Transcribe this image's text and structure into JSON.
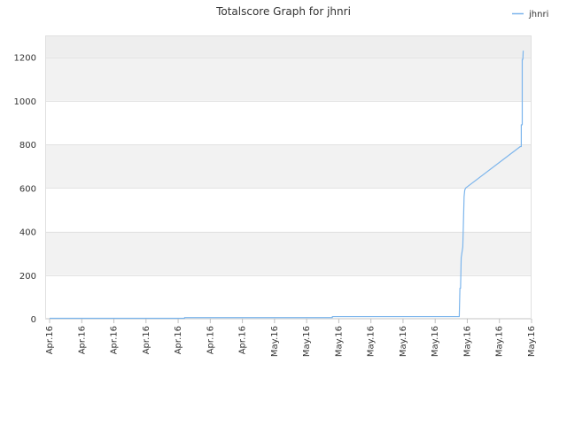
{
  "chart_data": {
    "type": "line",
    "title": "Totalscore Graph for jhnri",
    "xlabel": "",
    "ylabel": "",
    "ylim": [
      0,
      1300
    ],
    "y_ticks": [
      0,
      200,
      400,
      600,
      800,
      1000,
      1200
    ],
    "x_tick_labels": [
      "Apr.16",
      "Apr.16",
      "Apr.16",
      "Apr.16",
      "Apr.16",
      "Apr.16",
      "Apr.16",
      "May.16",
      "May.16",
      "May.16",
      "May.16",
      "May.16",
      "May.16",
      "May.16",
      "May.16",
      "May.16"
    ],
    "grid": true,
    "legend_position": "top-right",
    "series": [
      {
        "name": "jhnri",
        "color": "#7cb5ec",
        "x": [
          0,
          4.2,
          4.2,
          8.8,
          8.8,
          12.75,
          12.77,
          12.79,
          12.81,
          12.83,
          12.86,
          12.9,
          12.92,
          12.95,
          14.65,
          14.68,
          14.68,
          14.71,
          14.71,
          14.73,
          14.74
        ],
        "y": [
          2,
          2,
          5,
          5,
          10,
          10,
          140,
          140,
          280,
          300,
          330,
          560,
          590,
          600,
          790,
          790,
          890,
          890,
          1190,
          1190,
          1230
        ]
      }
    ]
  }
}
